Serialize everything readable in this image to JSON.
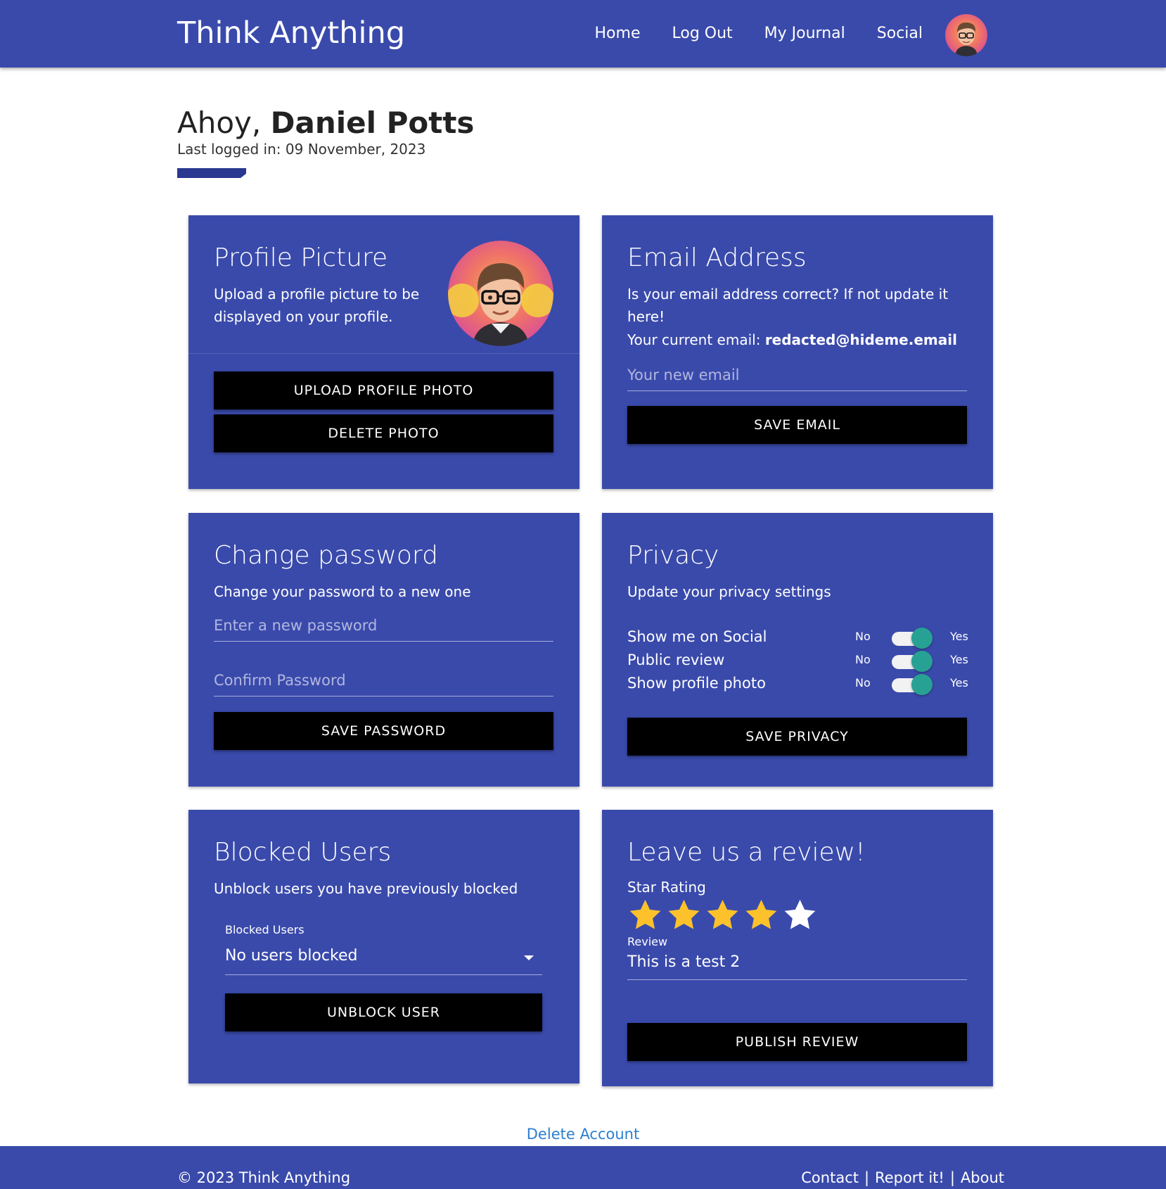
{
  "header": {
    "brand": "Think Anything",
    "nav": [
      {
        "label": "Home"
      },
      {
        "label": "Log Out"
      },
      {
        "label": "My Journal"
      },
      {
        "label": "Social"
      }
    ]
  },
  "greeting": {
    "prefix": "Ahoy, ",
    "name": "Daniel Potts",
    "last_login": "Last logged in: 09 November, 2023"
  },
  "profile_picture": {
    "title": "Profile Picture",
    "description": "Upload a profile picture to be displayed on your profile.",
    "upload_label": "UPLOAD PROFILE PHOTO",
    "delete_label": "DELETE PHOTO"
  },
  "email": {
    "title": "Email Address",
    "description": "Is your email address correct? If not update it here!",
    "current_prefix": "Your current email: ",
    "current_value": "redacted@hideme.email",
    "new_placeholder": "Your new email",
    "save_label": "SAVE EMAIL"
  },
  "password": {
    "title": "Change password",
    "description": "Change your password to a new one",
    "new_placeholder": "Enter a new password",
    "confirm_placeholder": "Confirm Password",
    "save_label": "SAVE PASSWORD"
  },
  "privacy": {
    "title": "Privacy",
    "description": "Update your privacy settings",
    "no_label": "No",
    "yes_label": "Yes",
    "settings": [
      {
        "label": "Show me on Social",
        "enabled": true
      },
      {
        "label": "Public review",
        "enabled": true
      },
      {
        "label": "Show profile photo",
        "enabled": true
      }
    ],
    "save_label": "SAVE PRIVACY"
  },
  "blocked": {
    "title": "Blocked Users",
    "description": "Unblock users you have previously blocked",
    "select_label": "Blocked Users",
    "selected": "No users blocked",
    "unblock_label": "UNBLOCK USER"
  },
  "review": {
    "title": "Leave us a review!",
    "star_label": "Star Rating",
    "rating": 4,
    "max_rating": 5,
    "review_label": "Review",
    "review_text": "This is a test 2",
    "publish_label": "PUBLISH REVIEW"
  },
  "delete_account_label": "Delete Account",
  "footer": {
    "copyright": "© 2023 Think Anything",
    "links": [
      {
        "label": "Contact"
      },
      {
        "label": "Report it!"
      },
      {
        "label": "About"
      }
    ],
    "separator": "|"
  },
  "colors": {
    "primary": "#3a4aab",
    "toggle_on": "#27a193",
    "star_filled": "#fdc22b",
    "star_empty": "#ffffff",
    "link": "#2b7fd1"
  }
}
